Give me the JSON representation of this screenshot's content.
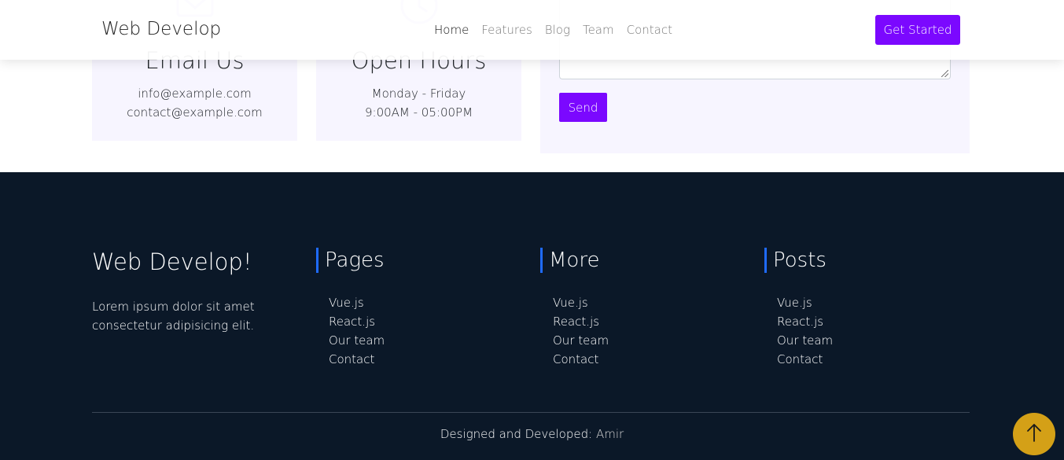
{
  "navbar": {
    "brand": "Web Develop",
    "links": [
      "Home",
      "Features",
      "Blog",
      "Team",
      "Contact"
    ],
    "active": "Home",
    "cta_label": "Get Started",
    "accent": "#7b08ff"
  },
  "contact": {
    "email_card": {
      "icon": "envelope-icon",
      "title": "Email Us",
      "line1": "info@example.com",
      "line2": "contact@example.com"
    },
    "hours_card": {
      "icon": "clock-icon",
      "title": "Open Hours",
      "line1": "Monday - Friday",
      "line2": "9:00AM - 05:00PM"
    },
    "form": {
      "send_label": "Send"
    }
  },
  "footer": {
    "brand_title": "Web Develop!",
    "brand_text": "Lorem ipsum dolor sit amet consectetur adipisicing elit.",
    "columns": [
      {
        "title": "Pages",
        "items": [
          "Vue.js",
          "React.js",
          "Our team",
          "Contact"
        ]
      },
      {
        "title": "More",
        "items": [
          "Vue.js",
          "React.js",
          "Our team",
          "Contact"
        ]
      },
      {
        "title": "Posts",
        "items": [
          "Vue.js",
          "React.js",
          "Our team",
          "Contact"
        ]
      }
    ],
    "credit_prefix": "Designed and Developed:",
    "credit_author": "Amir",
    "background": "#0b1828"
  },
  "back_to_top": {
    "icon": "arrow-up-icon",
    "color": "#d4a017"
  }
}
